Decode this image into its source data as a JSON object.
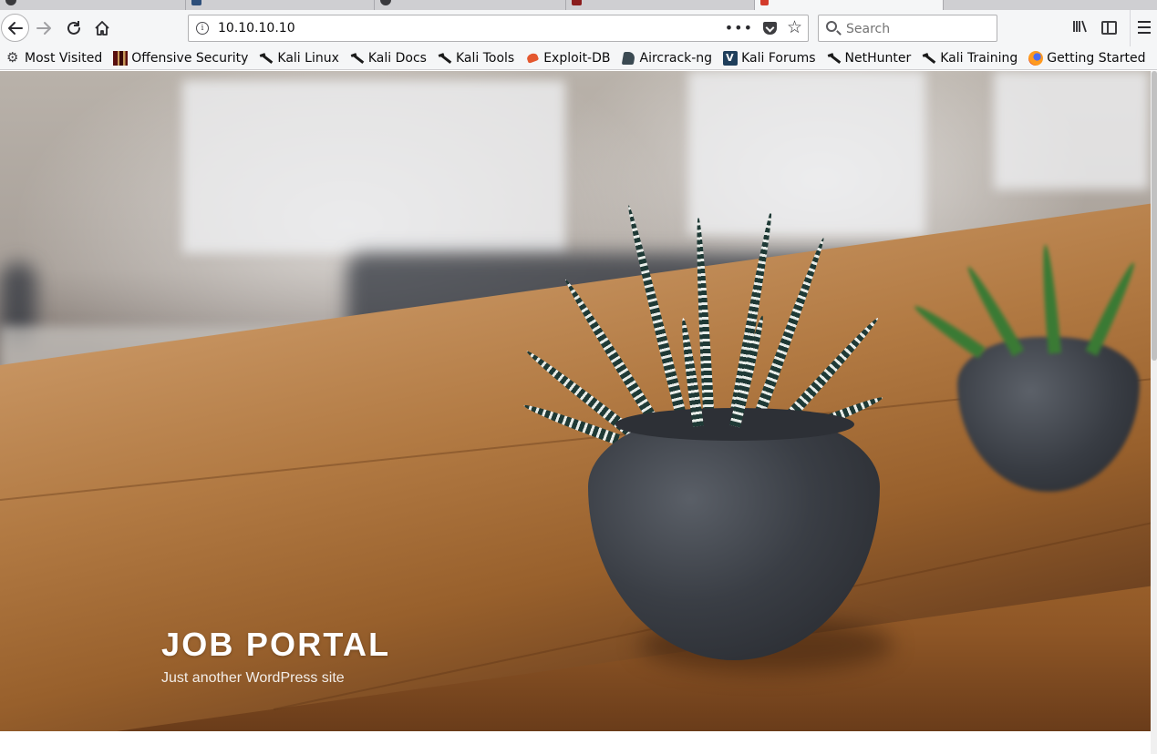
{
  "browser": {
    "url": "10.10.10.10",
    "search_placeholder": "Search",
    "more_actions": "•••",
    "bookmarks": [
      {
        "label": "Most Visited",
        "icon": "gear-icon"
      },
      {
        "label": "Offensive Security",
        "icon": "offensive-security-icon"
      },
      {
        "label": "Kali Linux",
        "icon": "kali-dragon-icon"
      },
      {
        "label": "Kali Docs",
        "icon": "kali-dragon-icon"
      },
      {
        "label": "Kali Tools",
        "icon": "kali-dragon-icon"
      },
      {
        "label": "Exploit-DB",
        "icon": "exploit-db-icon"
      },
      {
        "label": "Aircrack-ng",
        "icon": "aircrack-icon"
      },
      {
        "label": "Kali Forums",
        "icon": "kali-forums-icon"
      },
      {
        "label": "NetHunter",
        "icon": "kali-dragon-icon"
      },
      {
        "label": "Kali Training",
        "icon": "kali-dragon-icon"
      },
      {
        "label": "Getting Started",
        "icon": "firefox-icon"
      }
    ]
  },
  "site": {
    "title": "JOB PORTAL",
    "description": "Just another WordPress site"
  }
}
